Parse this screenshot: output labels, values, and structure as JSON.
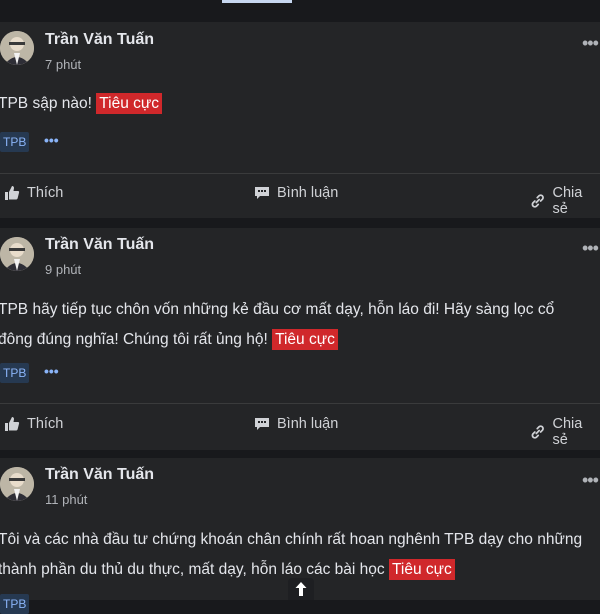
{
  "posts": [
    {
      "author": "Trần Văn Tuấn",
      "time": "7 phút",
      "lines": [
        "TPB sập nào!"
      ],
      "sentiment": "Tiêu cực",
      "tag": "TPB"
    },
    {
      "author": "Trần Văn Tuấn",
      "time": "9 phút",
      "lines": [
        "TPB hãy tiếp tục chôn vốn những kẻ đầu cơ mất dạy, hỗn láo đi! Hãy sàng lọc cổ",
        "đông đúng nghĩa! Chúng tôi rất ủng hộ!"
      ],
      "sentiment": "Tiêu cực",
      "tag": "TPB"
    },
    {
      "author": "Trần Văn Tuấn",
      "time": "11 phút",
      "lines": [
        "Tôi và các nhà đầu tư chứng khoán chân chính rất hoan nghênh TPB dạy cho những",
        "thành phần du thủ du thực, mất dạy, hỗn láo các bài học"
      ],
      "sentiment": "Tiêu cực",
      "tag": "TPB"
    }
  ],
  "actions": {
    "like": "Thích",
    "comment": "Bình luận",
    "share": "Chia sẻ"
  },
  "icons": {
    "more": "more-horizontal-icon",
    "like": "thumbs-up-icon",
    "comment": "comment-icon",
    "share": "share-link-icon",
    "scroll": "arrow-up-icon"
  },
  "colors": {
    "background": "#18191c",
    "card": "#242527",
    "negative_badge": "#d0282b",
    "tag_bg": "#263951",
    "tag_text": "#8ab4f8"
  }
}
